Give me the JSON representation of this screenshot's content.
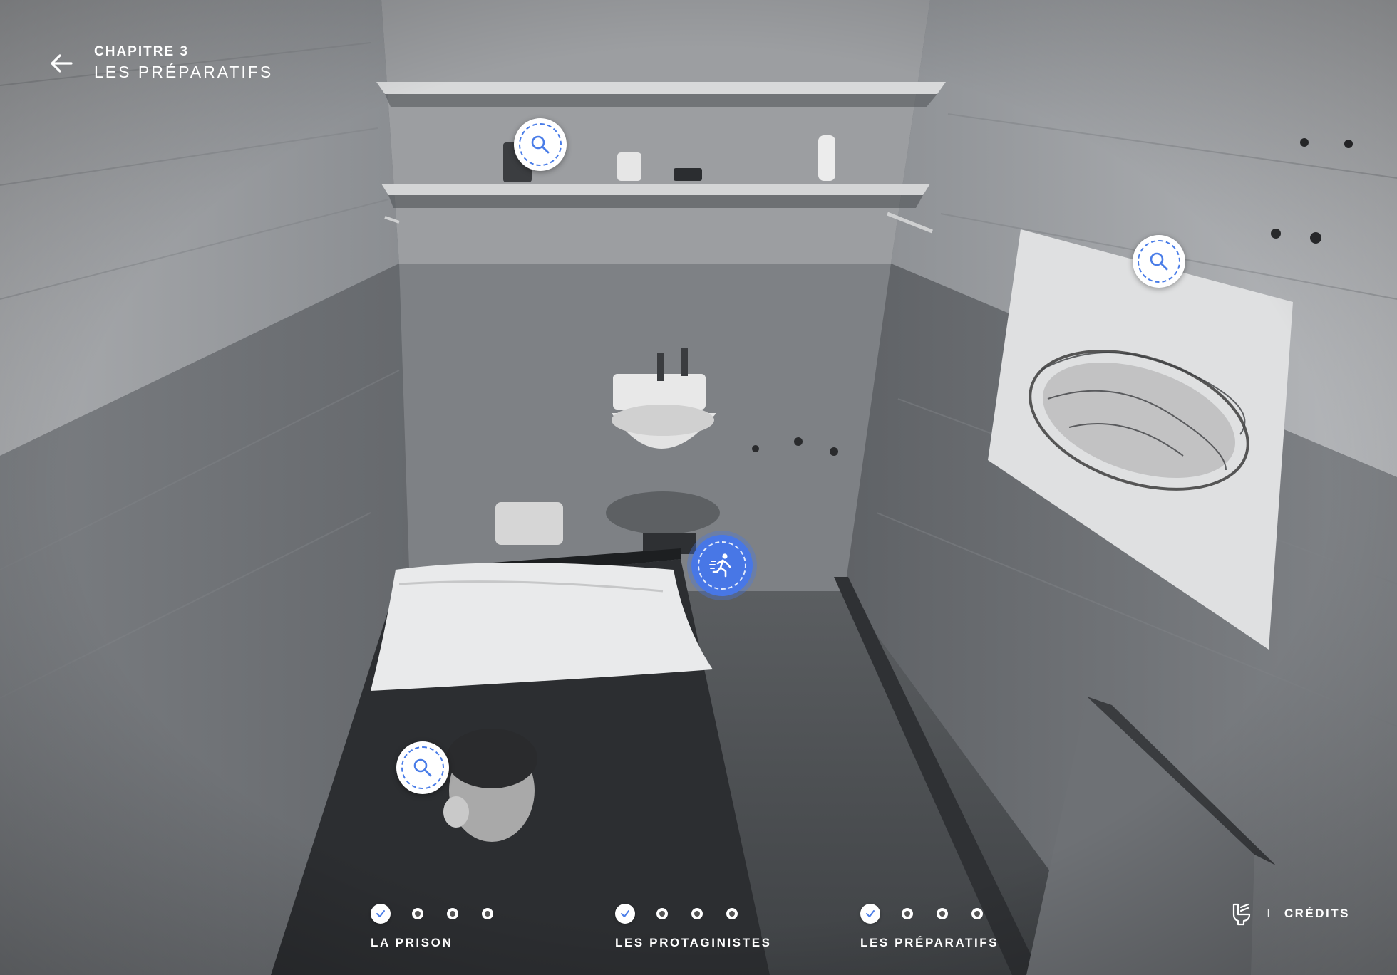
{
  "header": {
    "chapter_number": "CHAPITRE 3",
    "chapter_title": "LES PRÉPARATIFS",
    "back_icon": "arrow-left-icon"
  },
  "hotspots": {
    "icon": "magnifier-icon",
    "action_icon": "running-figure-icon"
  },
  "progress": {
    "chapters": [
      {
        "label": "LA PRISON",
        "completed_steps": 1,
        "total_steps": 4
      },
      {
        "label": "LES PROTAGINISTES",
        "completed_steps": 1,
        "total_steps": 4
      },
      {
        "label": "LES PRÉPARATIFS",
        "completed_steps": 1,
        "total_steps": 4
      }
    ]
  },
  "footer": {
    "credits_label": "CRÉDITS",
    "separator": "I",
    "credits_icon": "toilet-icon"
  },
  "colors": {
    "accent": "#4877e6",
    "hotspot_bg": "#ffffff",
    "text": "#ffffff"
  }
}
